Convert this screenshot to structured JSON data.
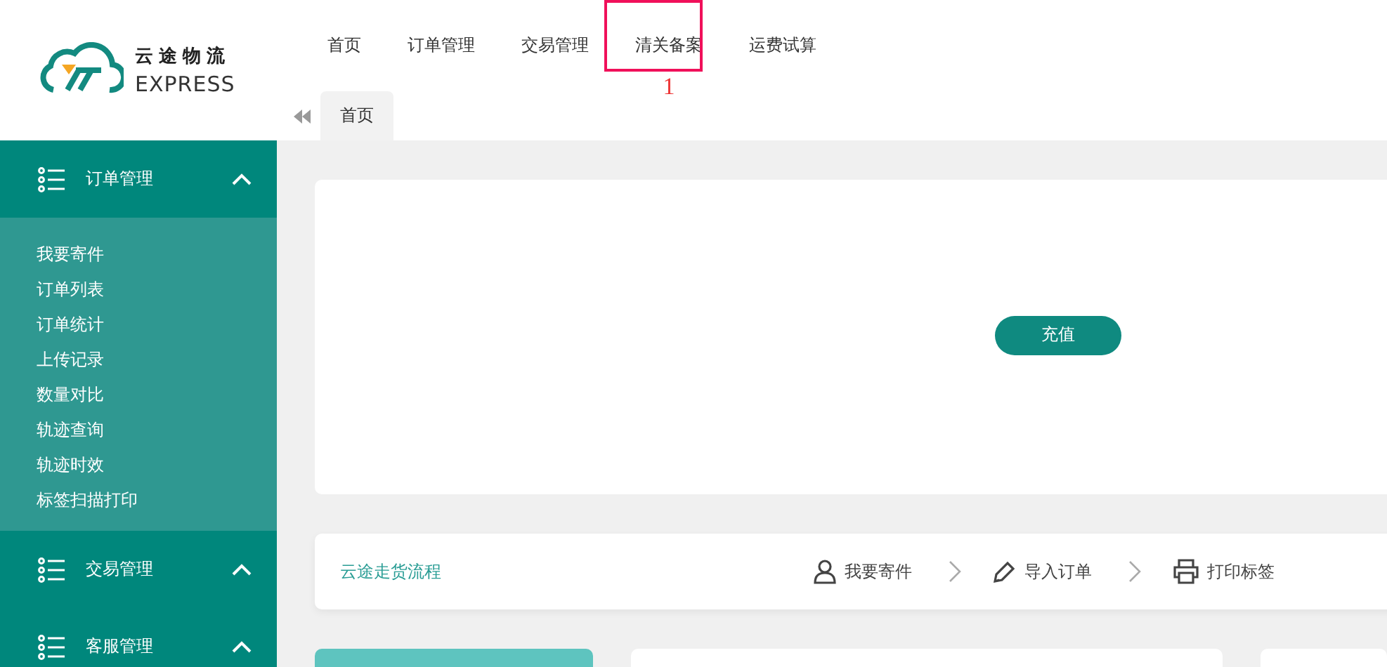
{
  "logo": {
    "name": "云途物流",
    "subtitle": "EXPRESS"
  },
  "top_nav": [
    {
      "label": "首页",
      "annotated": false
    },
    {
      "label": "订单管理",
      "annotated": false
    },
    {
      "label": "交易管理",
      "annotated": false
    },
    {
      "label": "清关备案",
      "annotated": true,
      "annotation": "1"
    },
    {
      "label": "运费试算",
      "annotated": false
    }
  ],
  "tabs": [
    {
      "label": "首页",
      "selected": true
    }
  ],
  "sidebar": [
    {
      "label": "订单管理",
      "expanded": true,
      "children": [
        "我要寄件",
        "订单列表",
        "订单统计",
        "上传记录",
        "数量对比",
        "轨迹查询",
        "轨迹时效",
        "标签扫描打印"
      ]
    },
    {
      "label": "交易管理",
      "expanded": false
    },
    {
      "label": "客服管理",
      "expanded": false
    }
  ],
  "recharge_button": "充值",
  "process": {
    "title": "云途走货流程",
    "steps": [
      {
        "kind": "person",
        "label": "我要寄件"
      },
      {
        "kind": "pen",
        "label": "导入订单"
      },
      {
        "kind": "printer",
        "label": "打印标签"
      }
    ]
  }
}
